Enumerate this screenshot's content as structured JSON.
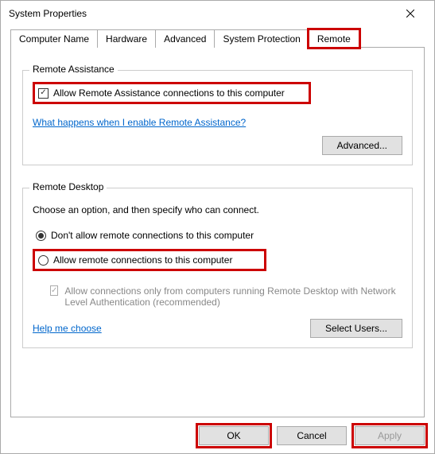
{
  "window": {
    "title": "System Properties"
  },
  "tabs": {
    "items": [
      "Computer Name",
      "Hardware",
      "Advanced",
      "System Protection",
      "Remote"
    ],
    "active": 4
  },
  "remoteAssistance": {
    "legend": "Remote Assistance",
    "allowLabel": "Allow Remote Assistance connections to this computer",
    "allowChecked": true,
    "link": "What happens when I enable Remote Assistance?",
    "advancedBtn": "Advanced..."
  },
  "remoteDesktop": {
    "legend": "Remote Desktop",
    "instruction": "Choose an option, and then specify who can connect.",
    "options": {
      "dont": "Don't allow remote connections to this computer",
      "allow": "Allow remote connections to this computer"
    },
    "selected": "dont",
    "nlaLabel": "Allow connections only from computers running Remote Desktop with Network Level Authentication (recommended)",
    "nlaChecked": true,
    "helpLink": "Help me choose",
    "selectUsersBtn": "Select Users..."
  },
  "buttons": {
    "ok": "OK",
    "cancel": "Cancel",
    "apply": "Apply"
  }
}
